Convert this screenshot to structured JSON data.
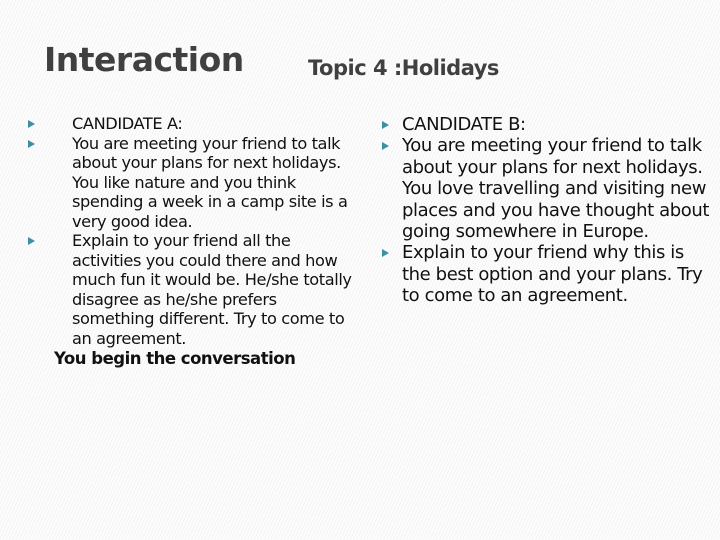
{
  "slide": {
    "title": "Interaction",
    "subtitle": "Topic 4 :Holidays"
  },
  "candidate_a": {
    "items": [
      "CANDIDATE A:",
      "You are meeting your friend to talk about your plans for next holidays. You like nature and you think spending a week in a camp site is a very good idea.",
      "Explain to your friend all the activities you could there and how much  fun it would be. He/she totally disagree as he/she prefers something different. Try to come to an agreement."
    ],
    "footer": "You begin the conversation"
  },
  "candidate_b": {
    "items": [
      "CANDIDATE B:",
      "You are meeting your friend to talk about your plans for next holidays. You love travelling and visiting new places and you have thought about going somewhere in Europe.",
      "Explain to your friend why this is the best option and your plans. Try to come to an agreement."
    ]
  },
  "colors": {
    "bullet": "#3d8fa6",
    "heading": "#404040",
    "body_text": "#111111"
  },
  "icons": {
    "bullet": "triangle-right-icon"
  }
}
